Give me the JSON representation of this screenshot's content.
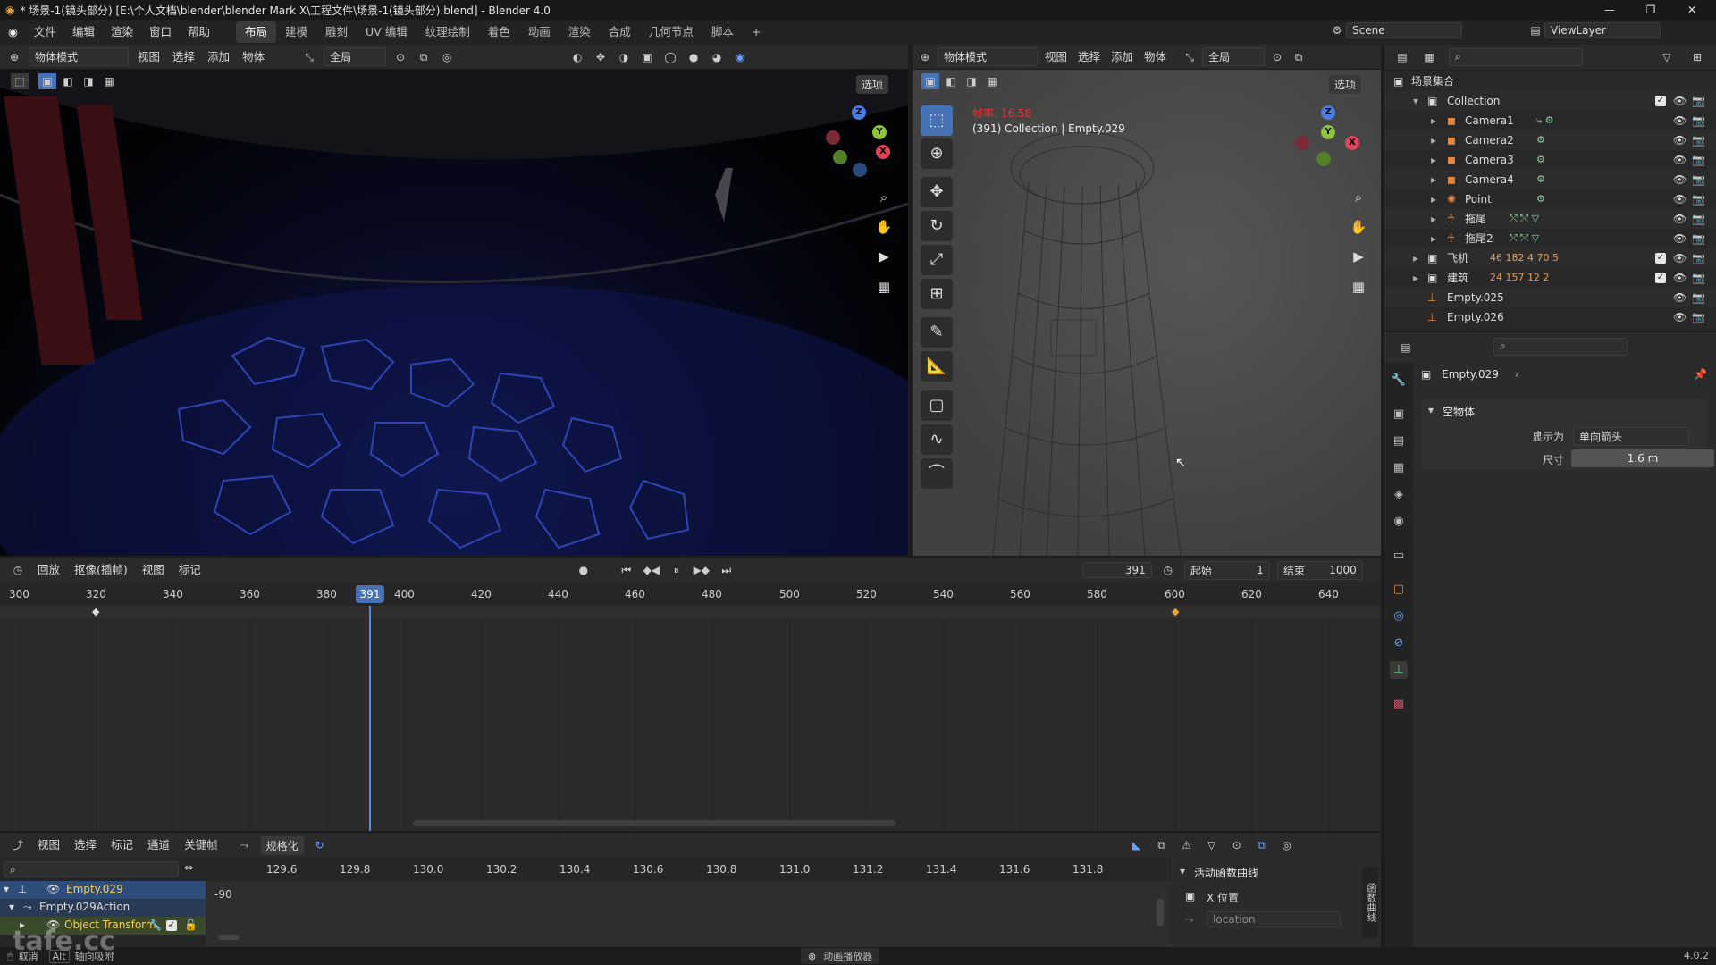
{
  "window": {
    "title": "* 场景-1(镜头部分) [E:\\个人文档\\blender\\blender Mark X\\工程文件\\场景-1(镜头部分).blend] - Blender 4.0",
    "controls": [
      "—",
      "❐",
      "✕"
    ]
  },
  "menu": {
    "items": [
      "文件",
      "编辑",
      "渲染",
      "窗口",
      "帮助"
    ],
    "workspaces": [
      "布局",
      "建模",
      "雕刻",
      "UV 编辑",
      "纹理绘制",
      "着色",
      "动画",
      "渲染",
      "合成",
      "几何节点",
      "脚本"
    ],
    "active_workspace": "布局",
    "add_tab": "+",
    "scene_label": "Scene",
    "view_layer_label": "ViewLayer"
  },
  "viewport_left": {
    "mode": "物体模式",
    "menus": [
      "视图",
      "选择",
      "添加",
      "物体"
    ],
    "transform": "全局",
    "options": "选项"
  },
  "viewport_right": {
    "mode": "物体模式",
    "menus": [
      "视图",
      "选择",
      "添加",
      "物体"
    ],
    "transform": "全局",
    "options": "选项",
    "fps_text": "帧率: 16.58",
    "info_text": "(391) Collection | Empty.029"
  },
  "gizmo": {
    "x": "X",
    "y": "Y",
    "z": "Z"
  },
  "outliner": {
    "root": "场景集合",
    "rows": [
      {
        "name": "Collection",
        "icons": "",
        "type": "collection"
      },
      {
        "name": "Camera1",
        "icons": "⤷ ⚙",
        "type": "camera"
      },
      {
        "name": "Camera2",
        "icons": "⚙",
        "type": "camera"
      },
      {
        "name": "Camera3",
        "icons": "⚙",
        "type": "camera"
      },
      {
        "name": "Camera4",
        "icons": "⚙",
        "type": "camera"
      },
      {
        "name": "Point",
        "icons": "⚙",
        "type": "light"
      },
      {
        "name": "拖尾",
        "icons": "⤲ ⤲ ▽",
        "type": "object"
      },
      {
        "name": "拖尾2",
        "icons": "⤲ ⤲ ▽",
        "type": "object"
      },
      {
        "name": "飞机",
        "icons": "46 182 4 70 5",
        "type": "collection"
      },
      {
        "name": "建筑",
        "icons": "24 157 12 2",
        "type": "collection"
      },
      {
        "name": "Empty.025",
        "icons": "",
        "type": "empty"
      },
      {
        "name": "Empty.026",
        "icons": "",
        "type": "empty"
      }
    ]
  },
  "properties": {
    "object_name": "Empty.029",
    "panel_title": "空物体",
    "display_as_label": "显示为",
    "display_as_value": "单向箭头",
    "size_label": "尺寸",
    "size_value": "1.6 m"
  },
  "timeline": {
    "menus": [
      "回放",
      "抠像(插帧)",
      "视图",
      "标记"
    ],
    "current_frame": "391",
    "start_label": "起始",
    "start_value": "1",
    "end_label": "结束",
    "end_value": "1000",
    "ruler_ticks": [
      "300",
      "320",
      "340",
      "360",
      "380",
      "400",
      "420",
      "440",
      "460",
      "480",
      "500",
      "520",
      "540",
      "560",
      "580",
      "600",
      "620",
      "640"
    ],
    "playhead_label": "391"
  },
  "graph_editor": {
    "menus": [
      "视图",
      "选择",
      "标记",
      "通道",
      "关键帧"
    ],
    "normalize": "规格化",
    "ruler_ticks": [
      "129.6",
      "129.8",
      "130.0",
      "130.2",
      "130.4",
      "130.6",
      "130.8",
      "131.0",
      "131.2",
      "131.4",
      "131.6",
      "131.8"
    ],
    "y_value": "-90",
    "channels": [
      "Empty.029",
      "Empty.029Action",
      "Object Transform"
    ],
    "fcurve_panel_title": "活动函数曲线",
    "fcurve_name": "X 位置",
    "fcurve_path": "location",
    "side_tab": "函数曲线"
  },
  "status": {
    "cancel": "取消",
    "alt_key": "Alt",
    "axis_snap": "轴向吸附",
    "center": "动画播放器",
    "version": "4.0.2",
    "watermark": "tafe.cc"
  }
}
